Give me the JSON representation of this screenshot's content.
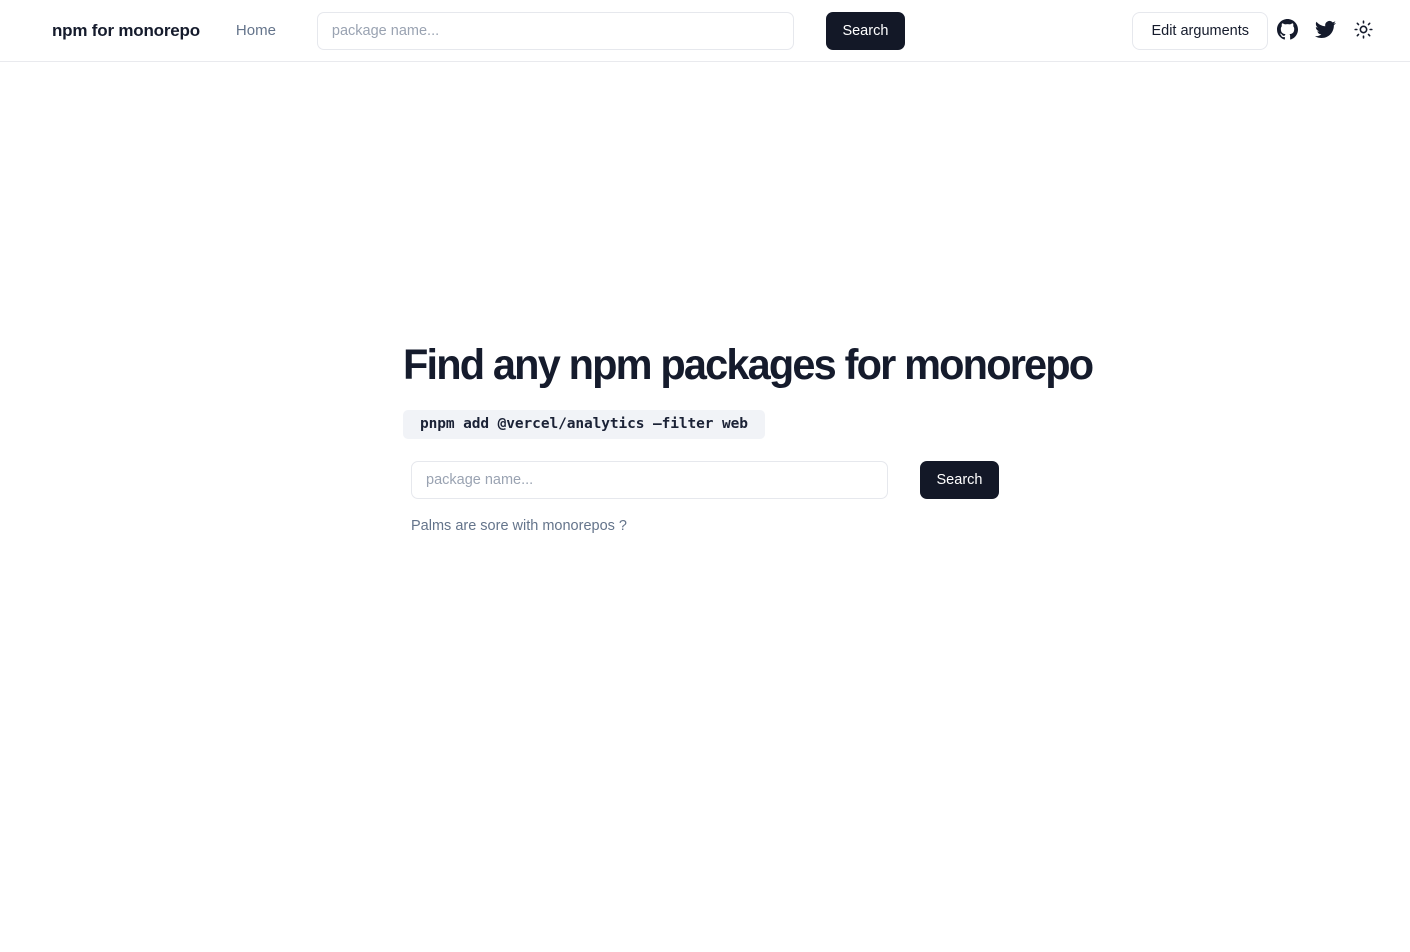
{
  "header": {
    "brand": "npm for monorepo",
    "nav": {
      "home_label": "Home"
    },
    "search": {
      "placeholder": "package name...",
      "value": "",
      "button_label": "Search"
    },
    "actions": {
      "edit_arguments_label": "Edit arguments",
      "github_icon": "github-icon",
      "twitter_icon": "twitter-icon",
      "theme_icon": "sun-icon"
    }
  },
  "main": {
    "title": "Find any npm packages for monorepo",
    "code_example": "pnpm add @vercel/analytics —filter web",
    "search": {
      "placeholder": "package name...",
      "value": "",
      "button_label": "Search"
    },
    "note": "Palms are sore with monorepos ?"
  },
  "colors": {
    "accent_dark": "#131827",
    "text_primary": "#151b2c",
    "text_muted": "#64748b",
    "border": "#e6e8ed",
    "code_bg": "#f1f3f7",
    "page_bg": "#ffffff"
  }
}
